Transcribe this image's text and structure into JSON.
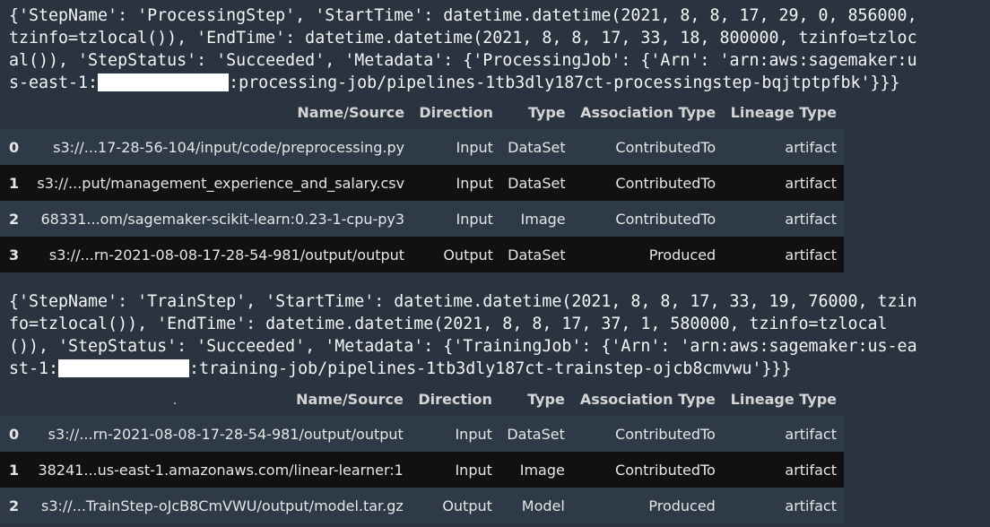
{
  "step1": {
    "text_a": "{'StepName': 'ProcessingStep', 'StartTime': datetime.datetime(2021, 8, 8, 17, 29, 0, 856000,\ntzinfo=tzlocal()), 'EndTime': datetime.datetime(2021, 8, 8, 17, 33, 18, 800000, tzinfo=tzloc\nal()), 'StepStatus': 'Succeeded', 'Metadata': {'ProcessingJob': {'Arn': 'arn:aws:sagemaker:u\ns-east-1:",
    "text_b": ":processing-job/pipelines-1tb3dly187ct-processingstep-bqjtptpfbk'}}}"
  },
  "table1": {
    "columns": [
      "",
      "Name/Source",
      "Direction",
      "Type",
      "Association Type",
      "Lineage Type"
    ],
    "rows": [
      [
        "0",
        "s3://...17-28-56-104/input/code/preprocessing.py",
        "Input",
        "DataSet",
        "ContributedTo",
        "artifact"
      ],
      [
        "1",
        "s3://...put/management_experience_and_salary.csv",
        "Input",
        "DataSet",
        "ContributedTo",
        "artifact"
      ],
      [
        "2",
        "68331...om/sagemaker-scikit-learn:0.23-1-cpu-py3",
        "Input",
        "Image",
        "ContributedTo",
        "artifact"
      ],
      [
        "3",
        "s3://...rn-2021-08-08-17-28-54-981/output/output",
        "Output",
        "DataSet",
        "Produced",
        "artifact"
      ]
    ]
  },
  "step2": {
    "text_a": "{'StepName': 'TrainStep', 'StartTime': datetime.datetime(2021, 8, 8, 17, 33, 19, 76000, tzin\nfo=tzlocal()), 'EndTime': datetime.datetime(2021, 8, 8, 17, 37, 1, 580000, tzinfo=tzlocal\n()), 'StepStatus': 'Succeeded', 'Metadata': {'TrainingJob': {'Arn': 'arn:aws:sagemaker:us-ea\nst-1:",
    "text_b": ":training-job/pipelines-1tb3dly187ct-trainstep-ojcb8cmvwu'}}}"
  },
  "table2": {
    "columns": [
      "",
      "Name/Source",
      "Direction",
      "Type",
      "Association Type",
      "Lineage Type"
    ],
    "rows": [
      [
        "0",
        "s3://...rn-2021-08-08-17-28-54-981/output/output",
        "Input",
        "DataSet",
        "ContributedTo",
        "artifact"
      ],
      [
        "1",
        "38241...us-east-1.amazonaws.com/linear-learner:1",
        "Input",
        "Image",
        "ContributedTo",
        "artifact"
      ],
      [
        "2",
        "s3://...TrainStep-oJcB8CmVWU/output/model.tar.gz",
        "Output",
        "Model",
        "Produced",
        "artifact"
      ]
    ]
  },
  "colors": {
    "background": "#2a3441",
    "row_dark": "#111111",
    "row_light": "#2f3a49",
    "redaction": "#ffffff"
  }
}
